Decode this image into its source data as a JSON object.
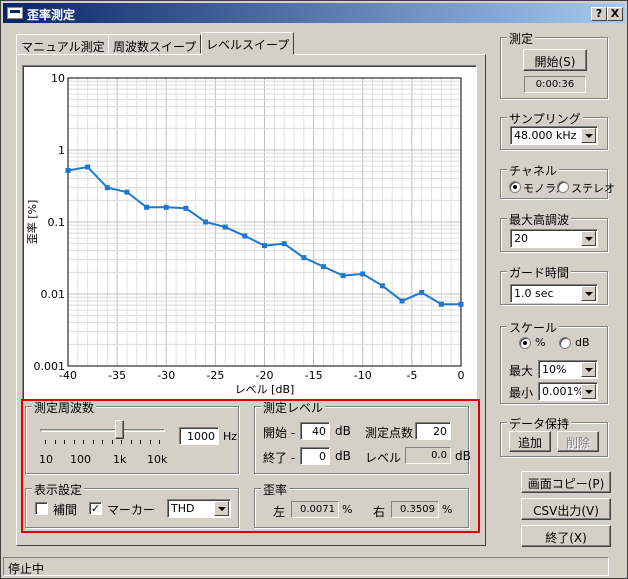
{
  "window": {
    "title": "歪率測定",
    "help_btn": "?",
    "close_btn": "X"
  },
  "tabs": [
    {
      "label": "マニュアル測定",
      "active": false
    },
    {
      "label": "周波数スイープ",
      "active": false
    },
    {
      "label": "レベルスイープ",
      "active": true
    }
  ],
  "chart_data": {
    "type": "line",
    "xlabel": "レベル [dB]",
    "ylabel": "歪率 [%]",
    "xlim": [
      -40,
      0
    ],
    "ylim": [
      0.001,
      10
    ],
    "yscale": "log",
    "grid": true,
    "x_ticks": [
      "-40",
      "-35",
      "-30",
      "-25",
      "-20",
      "-15",
      "-10",
      "-5",
      "0"
    ],
    "y_ticks": [
      "10",
      "1",
      "0.1",
      "0.01",
      "0.001"
    ],
    "color": "#1e78d2",
    "x": [
      -40,
      -38,
      -36,
      -34,
      -32,
      -30,
      -28,
      -26,
      -24,
      -22,
      -20,
      -18,
      -16,
      -14,
      -12,
      -10,
      -8,
      -6,
      -4,
      -2,
      0
    ],
    "y": [
      0.52,
      0.58,
      0.3,
      0.26,
      0.16,
      0.16,
      0.155,
      0.1,
      0.085,
      0.064,
      0.047,
      0.05,
      0.032,
      0.024,
      0.018,
      0.019,
      0.013,
      0.008,
      0.0105,
      0.0072,
      0.0072
    ]
  },
  "measure_freq": {
    "label": "測定周波数",
    "value": "1000",
    "unit": "Hz",
    "slider_ticks": [
      "10",
      "100",
      "1k",
      "10k"
    ],
    "slider_level": 0.63
  },
  "display": {
    "label": "表示設定",
    "interp_label": "補間",
    "interp_checked": false,
    "marker_label": "マーカー",
    "marker_checked": true,
    "mode_value": "THD"
  },
  "measure_level": {
    "label": "測定レベル",
    "start_label": "開始 -",
    "start_value": "40",
    "end_label": "終了 -",
    "end_value": "0",
    "db": "dB",
    "points_label": "測定点数",
    "points_value": "20",
    "level_label": "レベル",
    "level_value": "0.0",
    "level_unit": "dB"
  },
  "distortion": {
    "label": "歪率",
    "left_label": "左",
    "left_value": "0.0071",
    "right_label": "右",
    "right_value": "0.3509",
    "unit": "%"
  },
  "measure": {
    "label": "測定",
    "start_btn": "開始(S)",
    "time": "0:00:36"
  },
  "sampling": {
    "label": "サンプリング",
    "value": "48.000 kHz"
  },
  "channel": {
    "label": "チャネル",
    "mono": "モノラル",
    "stereo": "ステレオ",
    "selected": "mono"
  },
  "harmonic": {
    "label": "最大高調波",
    "value": "20"
  },
  "guard": {
    "label": "ガード時間",
    "value": "1.0 sec"
  },
  "scale": {
    "label": "スケール",
    "pct": "%",
    "db": "dB",
    "selected": "pct",
    "max_label": "最大",
    "max_value": "10%",
    "min_label": "最小",
    "min_value": "0.001%"
  },
  "data_hold": {
    "label": "データ保持",
    "add_btn": "追加",
    "del_btn": "削除"
  },
  "buttons": {
    "copy": "画面コピー(P)",
    "csv": "CSV出力(V)",
    "exit": "終了(X)"
  },
  "status": {
    "text": "停止中"
  }
}
